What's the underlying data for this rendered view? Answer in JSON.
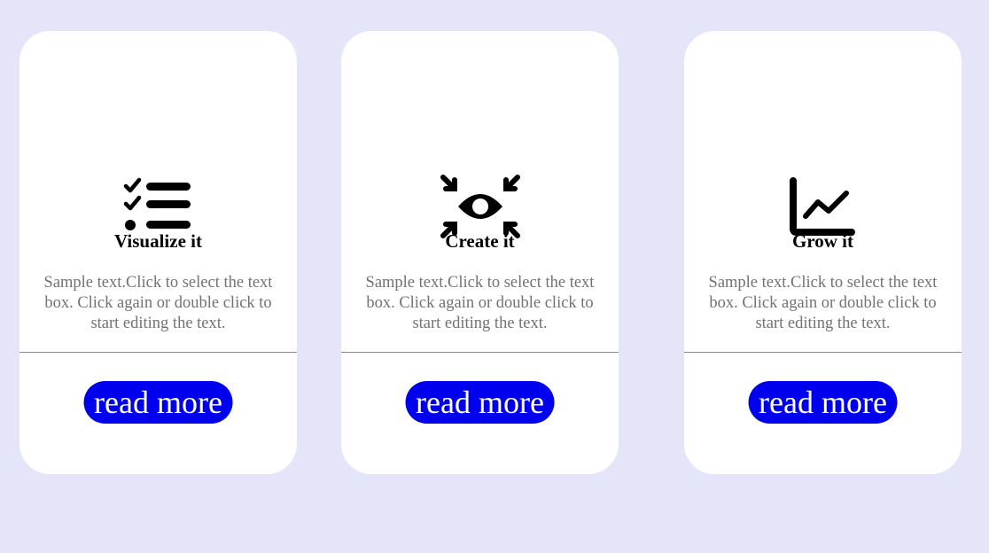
{
  "colors": {
    "page_background": "#e5e5f9",
    "card_background": "#ffffff",
    "button_background": "#0000ee",
    "button_text": "#ffffff",
    "description_text": "#727272"
  },
  "cards": [
    {
      "icon": "checklist-icon",
      "title": "Visualize it",
      "description": "Sample text.Click to select the text box. Click again or double click to start editing the text.",
      "button_label": "read more"
    },
    {
      "icon": "focus-eye-icon",
      "title": "Create it",
      "description": "Sample text.Click to select the text box. Click again or double click to start editing the text.",
      "button_label": "read more"
    },
    {
      "icon": "line-chart-icon",
      "title": "Grow it",
      "description": "Sample text.Click to select the text box. Click again or double click to start editing the text.",
      "button_label": "read more"
    }
  ]
}
